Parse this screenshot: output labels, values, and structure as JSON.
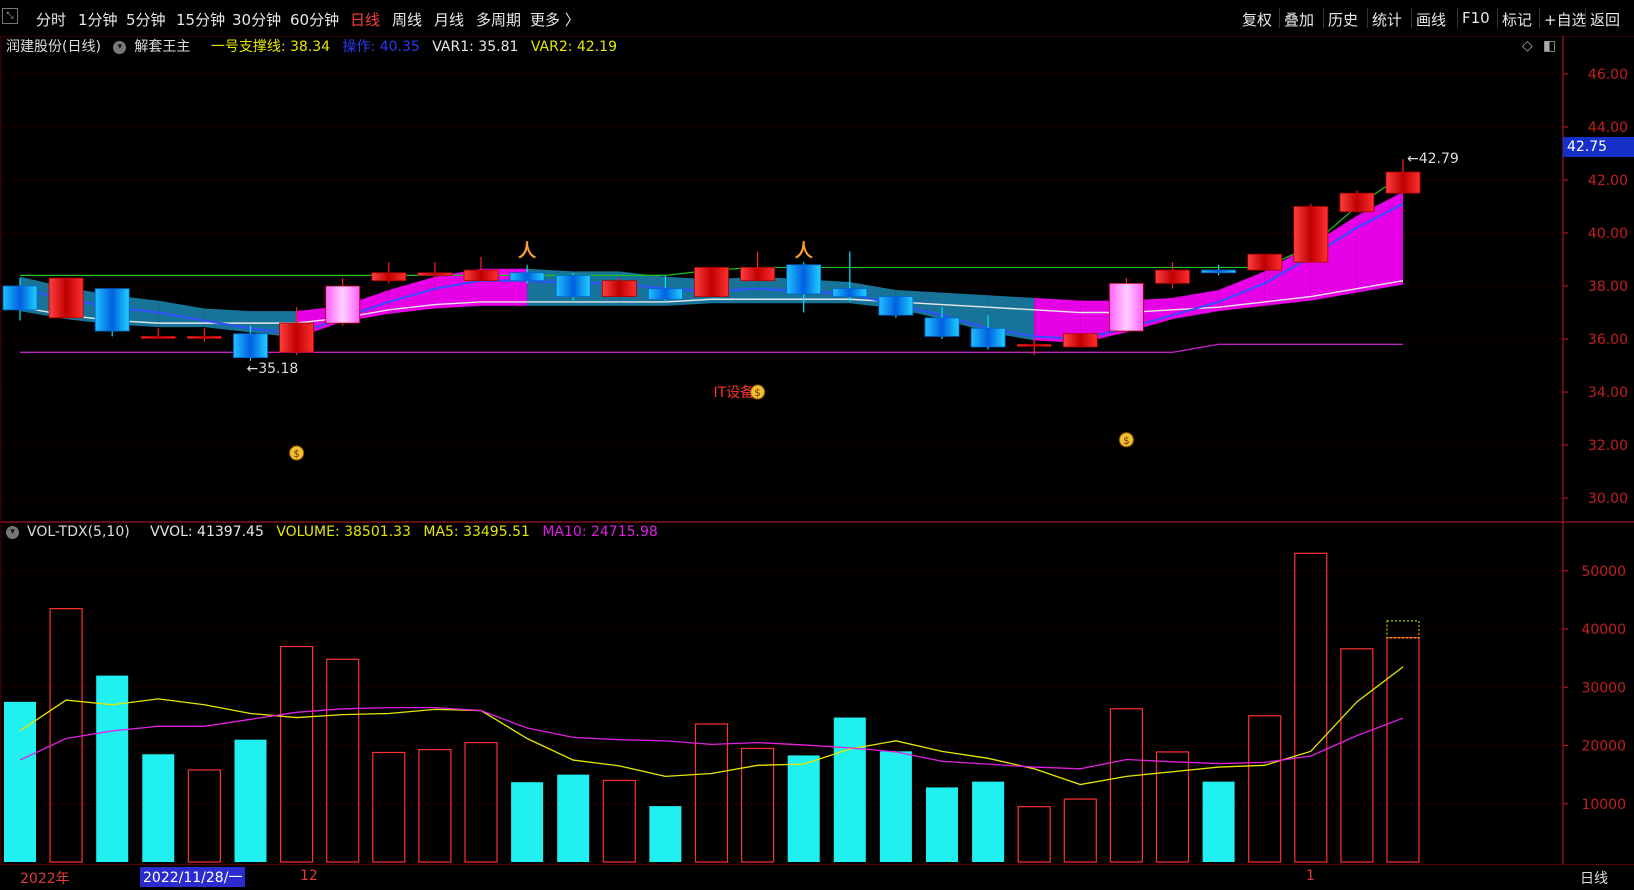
{
  "toolbar": {
    "left": [
      "分时",
      "1分钟",
      "5分钟",
      "15分钟",
      "30分钟",
      "60分钟",
      "日线",
      "周线",
      "月线",
      "多周期",
      "更多 〉"
    ],
    "active": "日线",
    "right": [
      "复权",
      "叠加",
      "历史",
      "统计",
      "画线",
      "F10",
      "标记",
      "+自选",
      "返回"
    ]
  },
  "infobar": {
    "stock": "润建股份(日线)",
    "indicator": "解套王主",
    "support": "一号支撑线: 38.34",
    "operate": "操作: 40.35",
    "var1": "VAR1: 35.81",
    "var2": "VAR2: 42.19"
  },
  "volbar": {
    "name": "VOL-TDX(5,10)",
    "vvol": "VVOL: 41397.45",
    "volume": "VOLUME: 38501.33",
    "ma5": "MA5: 33495.51",
    "ma10": "MA10: 24715.98"
  },
  "price_tag": "42.75",
  "annotations": {
    "high": "42.79",
    "low": "35.18",
    "news": "IT设备"
  },
  "bottom": {
    "year": "2022年",
    "date": "2022/11/28/一",
    "month12": "12",
    "month1": "1",
    "period": "日线"
  },
  "colors": {
    "up": "#ff2020",
    "down": "#00e5ff",
    "axis": "#c02020",
    "ma5": "#e6e600",
    "ma10": "#e020e0",
    "support": "#20c020",
    "band": "#ff00ff"
  },
  "chart_data": [
    {
      "type": "candlestick",
      "title": "",
      "ylim": [
        29.4,
        46.6
      ],
      "yticks": [
        46.0,
        44.0,
        42.0,
        40.0,
        38.0,
        36.0,
        34.0,
        32.0,
        30.0
      ],
      "candles": [
        {
          "o": 38.0,
          "h": 38.3,
          "c": 37.1,
          "l": 36.7
        },
        {
          "o": 36.8,
          "h": 38.3,
          "c": 38.3,
          "l": 36.8
        },
        {
          "o": 37.9,
          "h": 37.9,
          "c": 36.3,
          "l": 36.1
        },
        {
          "o": 36.1,
          "h": 36.4,
          "c": 36.1,
          "l": 36.0
        },
        {
          "o": 36.1,
          "h": 36.4,
          "c": 36.1,
          "l": 35.9
        },
        {
          "o": 36.2,
          "h": 36.5,
          "c": 35.3,
          "l": 35.18
        },
        {
          "o": 35.5,
          "h": 37.2,
          "c": 36.6,
          "l": 35.4
        },
        {
          "o": 36.6,
          "h": 38.3,
          "c": 38.0,
          "l": 36.5
        },
        {
          "o": 38.2,
          "h": 38.9,
          "c": 38.5,
          "l": 38.1
        },
        {
          "o": 38.4,
          "h": 38.9,
          "c": 38.5,
          "l": 38.3
        },
        {
          "o": 38.2,
          "h": 39.1,
          "c": 38.6,
          "l": 38.2
        },
        {
          "o": 38.5,
          "h": 38.8,
          "c": 38.2,
          "l": 38.1
        },
        {
          "o": 38.4,
          "h": 38.5,
          "c": 37.6,
          "l": 37.4
        },
        {
          "o": 37.6,
          "h": 38.3,
          "c": 38.2,
          "l": 37.6
        },
        {
          "o": 37.9,
          "h": 38.4,
          "c": 37.5,
          "l": 37.4
        },
        {
          "o": 37.6,
          "h": 38.7,
          "c": 38.7,
          "l": 37.6
        },
        {
          "o": 38.2,
          "h": 39.3,
          "c": 38.7,
          "l": 38.2
        },
        {
          "o": 38.8,
          "h": 38.9,
          "c": 37.7,
          "l": 37.0
        },
        {
          "o": 37.9,
          "h": 39.3,
          "c": 37.6,
          "l": 37.4
        },
        {
          "o": 37.6,
          "h": 37.6,
          "c": 36.9,
          "l": 36.8
        },
        {
          "o": 36.8,
          "h": 37.2,
          "c": 36.1,
          "l": 36.0
        },
        {
          "o": 36.4,
          "h": 36.9,
          "c": 35.7,
          "l": 35.6
        },
        {
          "o": 35.8,
          "h": 36.0,
          "c": 35.8,
          "l": 35.4
        },
        {
          "o": 35.7,
          "h": 36.2,
          "c": 36.2,
          "l": 35.7
        },
        {
          "o": 36.3,
          "h": 38.3,
          "c": 38.1,
          "l": 36.3
        },
        {
          "o": 38.1,
          "h": 38.9,
          "c": 38.6,
          "l": 37.9
        },
        {
          "o": 38.6,
          "h": 38.8,
          "c": 38.5,
          "l": 38.4
        },
        {
          "o": 38.6,
          "h": 39.2,
          "c": 39.2,
          "l": 38.6
        },
        {
          "o": 38.9,
          "h": 41.1,
          "c": 41.0,
          "l": 38.9
        },
        {
          "o": 40.8,
          "h": 41.6,
          "c": 41.5,
          "l": 40.8
        },
        {
          "o": 41.5,
          "h": 42.79,
          "c": 42.3,
          "l": 41.5
        }
      ],
      "lines": {
        "support_green": [
          38.4,
          38.4,
          38.4,
          38.4,
          38.4,
          38.4,
          38.4,
          38.4,
          38.4,
          38.4,
          38.4,
          38.4,
          38.4,
          38.4,
          38.4,
          38.6,
          38.7,
          38.7,
          38.7,
          38.7,
          38.7,
          38.7,
          38.7,
          38.7,
          38.7,
          38.7,
          38.7,
          38.7,
          39.5,
          41.0,
          42.2
        ],
        "mid_blue": [
          37.9,
          37.5,
          37.2,
          37.0,
          36.7,
          36.4,
          36.2,
          36.8,
          37.4,
          37.9,
          38.2,
          38.2,
          38.1,
          38.1,
          37.9,
          37.8,
          37.9,
          37.8,
          37.7,
          37.3,
          36.9,
          36.4,
          36.1,
          36.0,
          36.4,
          36.9,
          37.4,
          38.1,
          39.1,
          40.2,
          41.1
        ],
        "white": [
          37.2,
          36.9,
          36.7,
          36.6,
          36.6,
          36.6,
          36.6,
          36.8,
          37.1,
          37.3,
          37.4,
          37.4,
          37.4,
          37.4,
          37.4,
          37.5,
          37.5,
          37.5,
          37.5,
          37.4,
          37.3,
          37.2,
          37.1,
          37.0,
          37.0,
          37.1,
          37.2,
          37.4,
          37.6,
          37.9,
          38.2
        ],
        "purple": [
          35.5,
          35.5,
          35.5,
          35.5,
          35.5,
          35.5,
          35.5,
          35.5,
          35.5,
          35.5,
          35.5,
          35.5,
          35.5,
          35.5,
          35.5,
          35.5,
          35.5,
          35.5,
          35.5,
          35.5,
          35.5,
          35.5,
          35.5,
          35.5,
          35.5,
          35.5,
          35.8,
          35.8,
          35.8,
          35.8,
          35.8
        ]
      }
    },
    {
      "type": "bar",
      "title": "VOL-TDX(5,10)",
      "ylim": [
        0,
        57000
      ],
      "yticks": [
        50000,
        40000,
        30000,
        20000,
        10000
      ],
      "volume": [
        27500,
        43500,
        32000,
        18500,
        15800,
        21000,
        37000,
        34800,
        18800,
        19300,
        20500,
        13700,
        15000,
        14000,
        9600,
        23700,
        19500,
        18300,
        24800,
        19000,
        12800,
        13800,
        9500,
        10800,
        26300,
        18900,
        13800,
        25100,
        53000,
        36600,
        38500
      ],
      "up": [
        false,
        true,
        false,
        false,
        true,
        false,
        true,
        true,
        true,
        true,
        true,
        false,
        false,
        true,
        false,
        true,
        true,
        false,
        false,
        false,
        false,
        false,
        true,
        true,
        true,
        true,
        false,
        true,
        true,
        true,
        true
      ],
      "ma5": [
        22500,
        27800,
        27000,
        28000,
        27000,
        25500,
        24800,
        25300,
        25500,
        26200,
        26000,
        21200,
        17500,
        16500,
        14700,
        15200,
        16600,
        16800,
        19400,
        20800,
        19000,
        17800,
        16000,
        13300,
        14700,
        15500,
        16300,
        16600,
        19000,
        27500,
        33500
      ],
      "ma10": [
        17500,
        21200,
        22500,
        23300,
        23300,
        24500,
        25700,
        26300,
        26500,
        26500,
        26000,
        23000,
        21400,
        21000,
        20800,
        20200,
        20500,
        20100,
        19600,
        18900,
        17300,
        16800,
        16300,
        16000,
        17600,
        17200,
        16900,
        17100,
        18200,
        21700,
        24700
      ]
    }
  ]
}
